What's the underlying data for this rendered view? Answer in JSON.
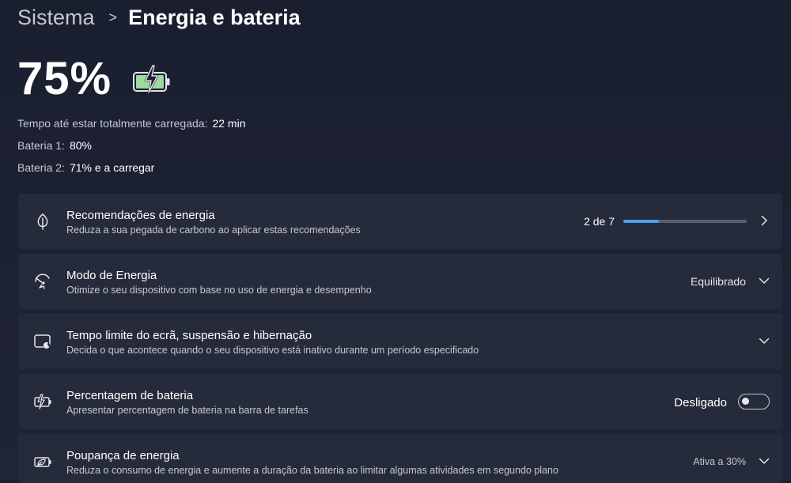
{
  "breadcrumb": {
    "parent": "Sistema",
    "separator": ">",
    "current": "Energia e bateria"
  },
  "hero": {
    "percent": "75%",
    "battery_level": 0.75
  },
  "info": [
    {
      "label": "Tempo até estar totalmente carregada:",
      "value": "22 min"
    },
    {
      "label": "Bateria 1:",
      "value": "80%"
    },
    {
      "label": "Bateria 2:",
      "value": "71% e a carregar"
    }
  ],
  "cards": {
    "recommendations": {
      "title": "Recomendações de energia",
      "desc": "Reduza a sua pegada de carbono ao aplicar estas recomendações",
      "progress_text": "2 de 7",
      "progress": 0.2857
    },
    "power_mode": {
      "title": "Modo de Energia",
      "desc": "Otimize o seu dispositivo com base no uso de energia e desempenho",
      "value": "Equilibrado"
    },
    "screen_sleep": {
      "title": "Tempo limite do ecrã, suspensão e hibernação",
      "desc": "Decida o que acontece quando o seu dispositivo está inativo durante um período especificado"
    },
    "battery_percentage": {
      "title": "Percentagem de bateria",
      "desc": "Apresentar percentagem de bateria na barra de tarefas",
      "toggle_label": "Desligado",
      "toggle_on": false
    },
    "energy_saver": {
      "title": "Poupança de energia",
      "desc": "Reduza o consumo de energia e aumente a duração da bateria ao limitar algumas atividades em segundo plano",
      "value": "Ativa a 30%"
    }
  },
  "icons": {
    "battery": "battery-charging-icon",
    "recommendations": "leaf-icon",
    "power_mode": "power-mode-icon",
    "screen": "screen-timeout-icon",
    "battery_pct": "battery-percentage-icon",
    "energy_saver": "energy-saver-icon",
    "chevron_right": "chevron-right-icon",
    "chevron_down": "chevron-down-icon"
  },
  "colors": {
    "accent": "#4aa0f0",
    "battery_fill": "#9fd9a0"
  }
}
